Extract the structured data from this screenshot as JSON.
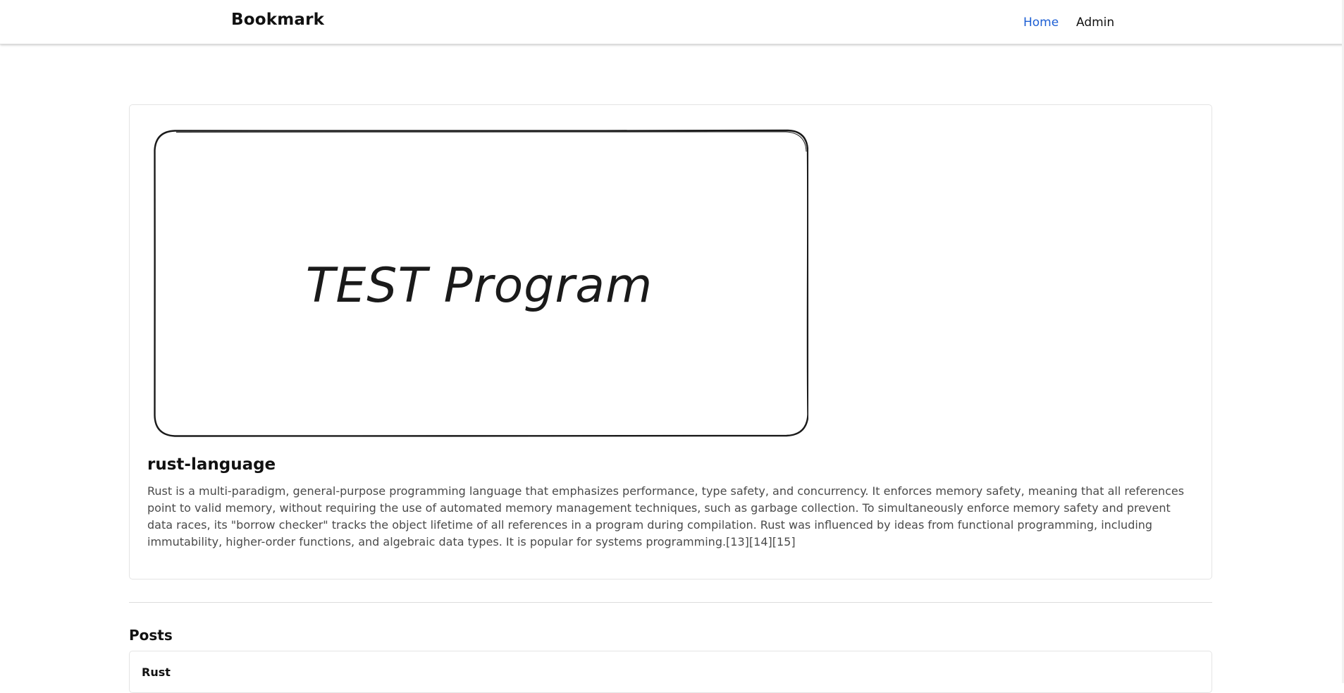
{
  "navbar": {
    "brand": "Bookmark",
    "links": [
      {
        "label": "Home",
        "active": true
      },
      {
        "label": "Admin",
        "active": false
      }
    ],
    "active_color": "#1d5fd4"
  },
  "card": {
    "image_text": "TEST Program",
    "title": "rust-language",
    "description": "Rust is a multi-paradigm, general-purpose programming language that emphasizes performance, type safety, and concurrency. It enforces memory safety, meaning that all references point to valid memory, without requiring the use of automated memory management techniques, such as garbage collection. To simultaneously enforce memory safety and prevent data races, its \"borrow checker\" tracks the object lifetime of all references in a program during compilation. Rust was influenced by ideas from functional programming, including immutability, higher-order functions, and algebraic data types. It is popular for systems programming.[13][14][15]"
  },
  "posts": {
    "heading": "Posts",
    "items": [
      {
        "title": "Rust"
      }
    ]
  }
}
